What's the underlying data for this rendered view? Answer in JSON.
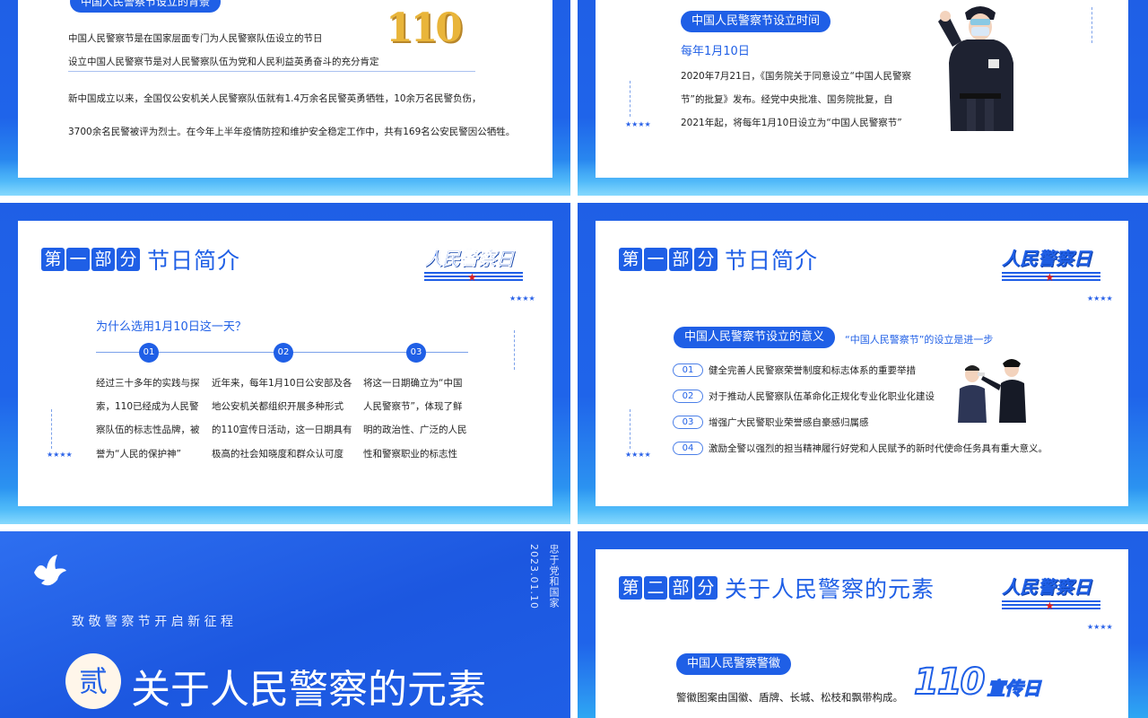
{
  "colors": {
    "primary": "#1f5fe6",
    "white": "#ffffff",
    "text": "#222222"
  },
  "slide1": {
    "pill": "中国人民警察节设立的背景",
    "badge": "110",
    "line1": "中国人民警察节是在国家层面专门为人民警察队伍设立的节日",
    "line2": "设立中国人民警察节是对人民警察队伍为党和人民利益英勇奋斗的充分肯定",
    "para1": "新中国成立以来，全国仅公安机关人民警察队伍就有1.4万余名民警英勇牺牲，10余万名民警负伤，",
    "para2": "3700余名民警被评为烈士。在今年上半年疫情防控和维护安全稳定工作中，共有169名公安民警因公牺牲。"
  },
  "slide2": {
    "pill": "中国人民警察节设立时间",
    "date": "每年1月10日",
    "p1": "2020年7月21日，《国务院关于同意设立“中国人民警察",
    "p2": "节”的批复》发布。经党中央批准、国务院批复，自",
    "p3": "2021年起，将每年1月10日设立为“中国人民警察节”",
    "stars": "★★★★"
  },
  "slide3": {
    "sec_chars": [
      "第",
      "一",
      "部",
      "分"
    ],
    "sec_rest": "节日简介",
    "logo": "人民警察日",
    "question": "为什么选用1月10日这一天？",
    "nums": [
      "01",
      "02",
      "03"
    ],
    "col1": [
      "经过三十多年的实践与探",
      "索，110已经成为人民警",
      "察队伍的标志性品牌，被",
      "誉为“人民的保护神”"
    ],
    "col2": [
      "近年来，每年1月10日公安部及各",
      "地公安机关都组织开展多种形式",
      "的110宣传日活动，这一日期具有",
      "极高的社会知晓度和群众认可度"
    ],
    "col3": [
      "将这一日期确立为“中国",
      "人民警察节”，体现了鲜",
      "明的政治性、广泛的人民",
      "性和警察职业的标志性"
    ],
    "stars": "★★★★"
  },
  "slide4": {
    "sec_chars": [
      "第",
      "一",
      "部",
      "分"
    ],
    "sec_rest": "节日简介",
    "logo": "人民警察日",
    "pill": "中国人民警察节设立的意义",
    "lead": "“中国人民警察节”的设立是进一步",
    "items": [
      {
        "num": "01",
        "text": "健全完善人民警察荣誉制度和标志体系的重要举措"
      },
      {
        "num": "02",
        "text": "对于推动人民警察队伍革命化正规化专业化职业化建设"
      },
      {
        "num": "03",
        "text": "增强广大民警职业荣誉感自豪感归属感"
      },
      {
        "num": "04",
        "text": "激励全警以强烈的担当精神履行好党和人民赋予的新时代使命任务具有重大意义。"
      }
    ],
    "stars": "★★★★"
  },
  "slide5": {
    "subtitle": "致 敬 警 察 节 开 启 新 征 程",
    "circle": "贰",
    "title": "关于人民警察的元素",
    "vertical1": "忠于党和国家",
    "vertical2": "2023.01.10"
  },
  "slide6": {
    "sec_chars": [
      "第",
      "二",
      "部",
      "分"
    ],
    "sec_rest": "关于人民警察的元素",
    "logo": "人民警察日",
    "pill": "中国人民警察警徽",
    "text": "警徽图案由国徽、盾牌、长城、松枝和飘带构成。",
    "badge_num": "110",
    "badge_text": "宣传日",
    "stars": "★★★★"
  }
}
